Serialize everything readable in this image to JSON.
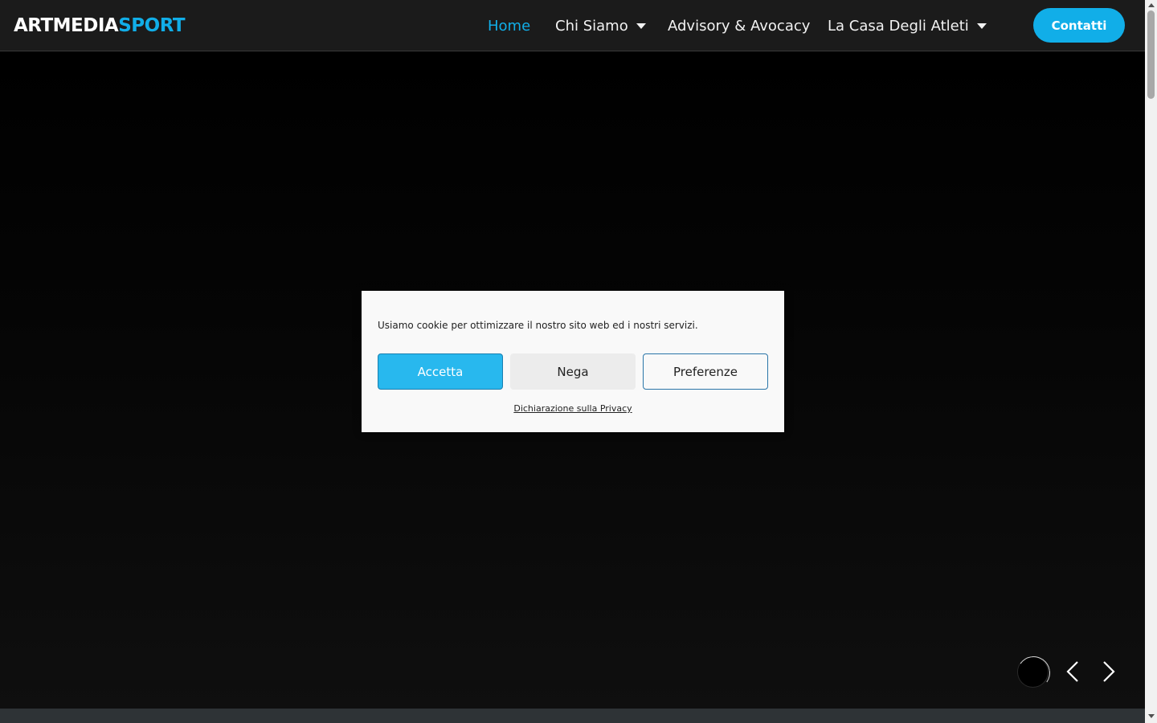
{
  "brand": {
    "logo_part1": "ARTMEDIA",
    "logo_part2": "SPORT"
  },
  "nav": {
    "items": [
      {
        "label": "Home",
        "active": true,
        "dropdown": false
      },
      {
        "label": "Chi Siamo",
        "active": false,
        "dropdown": true
      },
      {
        "label": "Advisory & Avocacy",
        "active": false,
        "dropdown": false
      },
      {
        "label": "La Casa Degli Atleti",
        "active": false,
        "dropdown": true
      }
    ],
    "cta_label": "Contatti"
  },
  "cookie_banner": {
    "message": "Usiamo cookie per ottimizzare il nostro sito web ed i nostri servizi.",
    "accept_label": "Accetta",
    "deny_label": "Nega",
    "preferences_label": "Preferenze",
    "privacy_link": "Dichiarazione sulla Privacy"
  },
  "icons": {
    "slider_prev": "chevron-left-icon",
    "slider_next": "chevron-right-icon",
    "dropdown": "caret-down-icon"
  },
  "colors": {
    "accent": "#11aee8",
    "accept_button": "#28b8ee",
    "header_bg": "#1b1b1b"
  }
}
